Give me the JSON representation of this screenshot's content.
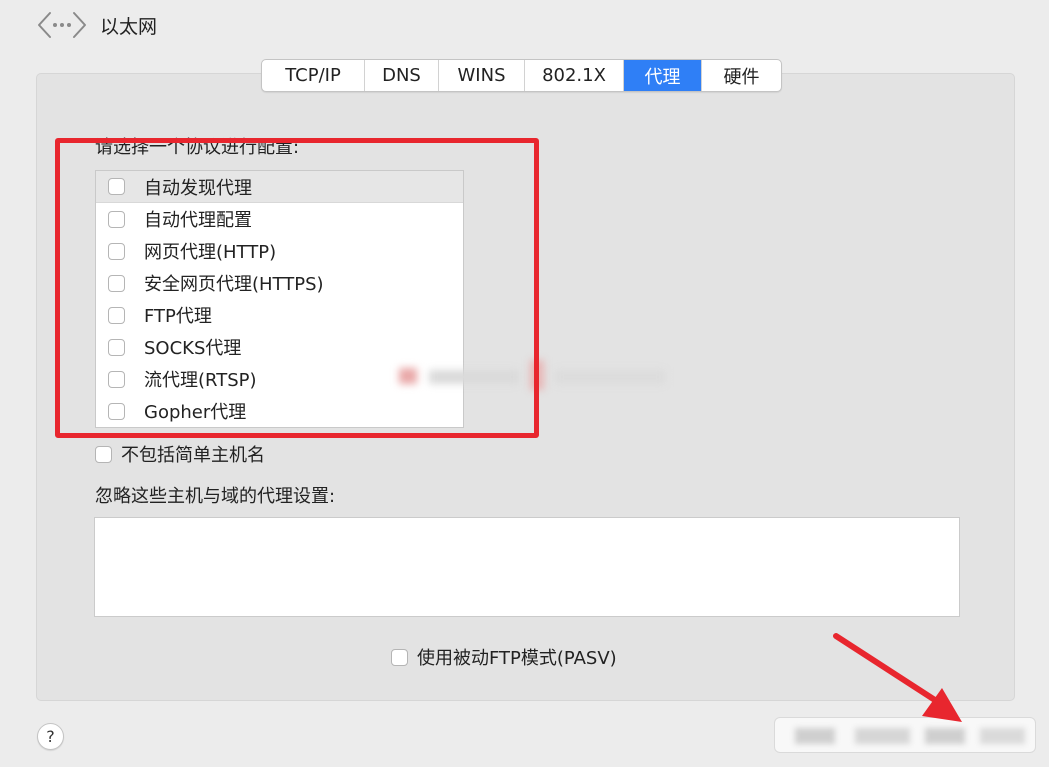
{
  "header": {
    "icon": "ethernet-arrows-icon",
    "title": "以太网"
  },
  "tabs": [
    {
      "label": "TCP/IP",
      "active": false
    },
    {
      "label": "DNS",
      "active": false
    },
    {
      "label": "WINS",
      "active": false
    },
    {
      "label": "802.1X",
      "active": false
    },
    {
      "label": "代理",
      "active": true
    },
    {
      "label": "硬件",
      "active": false
    }
  ],
  "proxy": {
    "section_label": "请选择一个协议进行配置:",
    "protocols": [
      {
        "label": "自动发现代理",
        "checked": false
      },
      {
        "label": "自动代理配置",
        "checked": false
      },
      {
        "label": "网页代理(HTTP)",
        "checked": false
      },
      {
        "label": "安全网页代理(HTTPS)",
        "checked": false
      },
      {
        "label": "FTP代理",
        "checked": false
      },
      {
        "label": "SOCKS代理",
        "checked": false
      },
      {
        "label": "流代理(RTSP)",
        "checked": false
      },
      {
        "label": "Gopher代理",
        "checked": false
      }
    ],
    "exclude_simple_hostnames": {
      "label": "不包括简单主机名",
      "checked": false
    },
    "bypass_label": "忽略这些主机与域的代理设置:",
    "bypass_value": "",
    "pasv": {
      "label": "使用被动FTP模式(PASV)",
      "checked": false
    }
  },
  "footer": {
    "help_label": "?"
  },
  "colors": {
    "accent": "#2f7ff6",
    "annotation_red": "#e8262e",
    "panel_bg": "#e3e3e3",
    "window_bg": "#ececec"
  }
}
